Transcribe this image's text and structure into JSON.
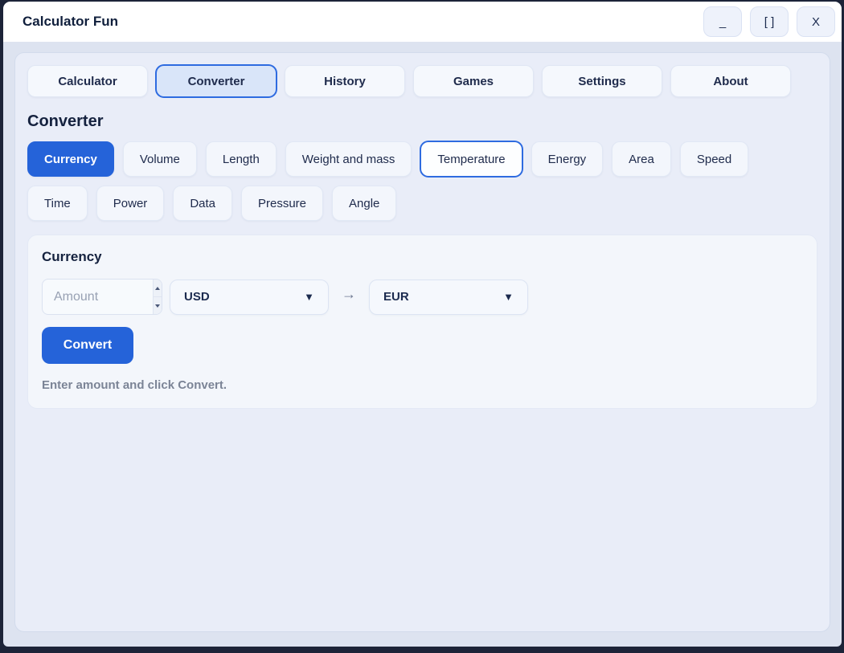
{
  "window": {
    "title": "Calculator Fun",
    "controls": [
      {
        "name": "minimize",
        "label": "_"
      },
      {
        "name": "maximize",
        "label": "[ ]"
      },
      {
        "name": "close",
        "label": "X"
      }
    ]
  },
  "tabs": [
    {
      "label": "Calculator",
      "selected": false
    },
    {
      "label": "Converter",
      "selected": true
    },
    {
      "label": "History",
      "selected": false
    },
    {
      "label": "Games",
      "selected": false
    },
    {
      "label": "Settings",
      "selected": false
    },
    {
      "label": "About",
      "selected": false
    }
  ],
  "converter": {
    "heading": "Converter",
    "categories": [
      {
        "label": "Currency",
        "state": "active"
      },
      {
        "label": "Volume",
        "state": "normal"
      },
      {
        "label": "Length",
        "state": "normal"
      },
      {
        "label": "Weight and mass",
        "state": "normal"
      },
      {
        "label": "Temperature",
        "state": "focused"
      },
      {
        "label": "Energy",
        "state": "normal"
      },
      {
        "label": "Area",
        "state": "normal"
      },
      {
        "label": "Speed",
        "state": "normal"
      },
      {
        "label": "Time",
        "state": "normal"
      },
      {
        "label": "Power",
        "state": "normal"
      },
      {
        "label": "Data",
        "state": "normal"
      },
      {
        "label": "Pressure",
        "state": "normal"
      },
      {
        "label": "Angle",
        "state": "normal"
      }
    ],
    "panel": {
      "heading": "Currency",
      "amount_placeholder": "Amount",
      "from_currency": "USD",
      "to_currency": "EUR",
      "arrow_icon": "→",
      "dropdown_arrow_icon": "▼",
      "convert_label": "Convert",
      "status_text": "Enter amount and click Convert."
    }
  },
  "colors": {
    "accent_blue": "#2563d9",
    "focus_blue": "#2e6be0",
    "window_border": "#1c2338",
    "title_text": "#101f3c",
    "content_bg": "#dde3f0",
    "panel_bg": "#e9edf8",
    "card_bg": "#f3f6fb",
    "status_gray": "#7b8496"
  }
}
